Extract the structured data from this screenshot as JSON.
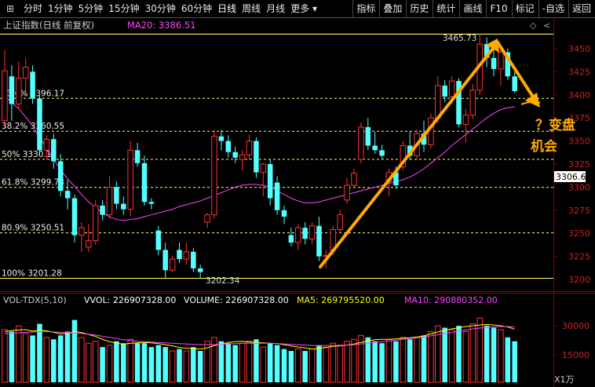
{
  "toolbar": {
    "left_icon": "⊞",
    "periods": [
      "分时",
      "1分钟",
      "5分钟",
      "15分钟",
      "30分钟",
      "60分钟",
      "日线",
      "周线",
      "月线",
      "更多 ▾"
    ],
    "active_period": "日线",
    "right_items": [
      "指标",
      "叠加",
      "历史",
      "统计",
      "画线",
      "F10",
      "标记",
      "-自选",
      "返回"
    ]
  },
  "colors": {
    "up": "#ff3232",
    "down": "#54ffff",
    "ma20": "#ff44ff",
    "ma5": "#ffffff",
    "ma10": "#ffff00",
    "fib": "#ffff66",
    "arrow": "#ffaa00",
    "grid": "#8b0000"
  },
  "main_panel": {
    "title": "上证指数(日线 前复权)",
    "ma_label": "MA20: 3386.51",
    "last_price": "3306.6",
    "high_label": "3465.73",
    "low_label": "3202.34",
    "annotation_line1": "？变盘",
    "annotation_line2": "机会",
    "icons": [
      "◇",
      "<"
    ]
  },
  "fib_levels": [
    {
      "label": "23.6% 3396.17",
      "value": 3396.17
    },
    {
      "label": "38.2% 3360.55",
      "value": 3360.55
    },
    {
      "label": "50% 3330.14",
      "value": 3330.14
    },
    {
      "label": "61.8% 3299.73",
      "value": 3299.73
    },
    {
      "label": "80.9% 3250.51",
      "value": 3250.51
    },
    {
      "label": "100% 3201.28",
      "value": 3201.28
    }
  ],
  "volume_panel": {
    "title": "VOL-TDX(5,10)",
    "vvol": "VVOL: 226907328.00",
    "volume": "VOLUME: 226907328.00",
    "ma5": "MA5: 269795520.00",
    "ma10": "MA10: 290880352.00",
    "unit": "X1万"
  },
  "chart_data": {
    "type": "candlestick",
    "price_axis": {
      "ylim": [
        3195,
        3463
      ],
      "ticks": [
        3200,
        3225,
        3250,
        3275,
        3300,
        3325,
        3350,
        3375,
        3400,
        3425,
        3450
      ]
    },
    "volume_axis": {
      "ylim": [
        8000,
        38000
      ],
      "ticks": [
        15000,
        30000
      ]
    },
    "candles": [
      {
        "o": 3372,
        "h": 3448,
        "l": 3364,
        "c": 3426,
        "v": 28000
      },
      {
        "o": 3420,
        "h": 3432,
        "l": 3372,
        "c": 3390,
        "v": 27000
      },
      {
        "o": 3390,
        "h": 3436,
        "l": 3385,
        "c": 3418,
        "v": 30000
      },
      {
        "o": 3418,
        "h": 3440,
        "l": 3400,
        "c": 3430,
        "v": 26000
      },
      {
        "o": 3425,
        "h": 3432,
        "l": 3390,
        "c": 3396,
        "v": 25000
      },
      {
        "o": 3396,
        "h": 3402,
        "l": 3335,
        "c": 3340,
        "v": 31000
      },
      {
        "o": 3340,
        "h": 3356,
        "l": 3330,
        "c": 3352,
        "v": 24000
      },
      {
        "o": 3352,
        "h": 3358,
        "l": 3320,
        "c": 3328,
        "v": 23000
      },
      {
        "o": 3328,
        "h": 3336,
        "l": 3290,
        "c": 3296,
        "v": 25000
      },
      {
        "o": 3296,
        "h": 3308,
        "l": 3276,
        "c": 3288,
        "v": 27000
      },
      {
        "o": 3288,
        "h": 3292,
        "l": 3240,
        "c": 3248,
        "v": 33000
      },
      {
        "o": 3248,
        "h": 3262,
        "l": 3230,
        "c": 3256,
        "v": 24000
      },
      {
        "o": 3235,
        "h": 3260,
        "l": 3230,
        "c": 3242,
        "v": 21000
      },
      {
        "o": 3242,
        "h": 3286,
        "l": 3238,
        "c": 3280,
        "v": 22000
      },
      {
        "o": 3280,
        "h": 3286,
        "l": 3264,
        "c": 3270,
        "v": 19000
      },
      {
        "o": 3270,
        "h": 3312,
        "l": 3266,
        "c": 3300,
        "v": 20000
      },
      {
        "o": 3300,
        "h": 3306,
        "l": 3276,
        "c": 3282,
        "v": 22000
      },
      {
        "o": 3282,
        "h": 3290,
        "l": 3270,
        "c": 3276,
        "v": 21000
      },
      {
        "o": 3276,
        "h": 3350,
        "l": 3268,
        "c": 3340,
        "v": 23000
      },
      {
        "o": 3340,
        "h": 3348,
        "l": 3322,
        "c": 3326,
        "v": 21000
      },
      {
        "o": 3326,
        "h": 3334,
        "l": 3280,
        "c": 3284,
        "v": 21000
      },
      {
        "o": 3284,
        "h": 3288,
        "l": 3276,
        "c": 3282,
        "v": 19000
      },
      {
        "o": 3253,
        "h": 3258,
        "l": 3226,
        "c": 3232,
        "v": 20000
      },
      {
        "o": 3232,
        "h": 3240,
        "l": 3202,
        "c": 3210,
        "v": 19000
      },
      {
        "o": 3210,
        "h": 3226,
        "l": 3208,
        "c": 3222,
        "v": 17000
      },
      {
        "o": 3232,
        "h": 3240,
        "l": 3218,
        "c": 3222,
        "v": 18000
      },
      {
        "o": 3222,
        "h": 3240,
        "l": 3216,
        "c": 3230,
        "v": 17000
      },
      {
        "o": 3230,
        "h": 3234,
        "l": 3208,
        "c": 3212,
        "v": 19000
      },
      {
        "o": 3212,
        "h": 3216,
        "l": 3202,
        "c": 3208,
        "v": 17000
      },
      {
        "o": 3262,
        "h": 3272,
        "l": 3256,
        "c": 3270,
        "v": 22000
      },
      {
        "o": 3270,
        "h": 3362,
        "l": 3266,
        "c": 3355,
        "v": 24000
      },
      {
        "o": 3355,
        "h": 3362,
        "l": 3340,
        "c": 3350,
        "v": 22000
      },
      {
        "o": 3350,
        "h": 3356,
        "l": 3332,
        "c": 3338,
        "v": 21000
      },
      {
        "o": 3338,
        "h": 3344,
        "l": 3326,
        "c": 3332,
        "v": 20000
      },
      {
        "o": 3330,
        "h": 3340,
        "l": 3318,
        "c": 3335,
        "v": 21000
      },
      {
        "o": 3335,
        "h": 3357,
        "l": 3330,
        "c": 3350,
        "v": 22000
      },
      {
        "o": 3350,
        "h": 3354,
        "l": 3310,
        "c": 3316,
        "v": 23000
      },
      {
        "o": 3316,
        "h": 3326,
        "l": 3290,
        "c": 3325,
        "v": 19000
      },
      {
        "o": 3325,
        "h": 3330,
        "l": 3280,
        "c": 3288,
        "v": 21000
      },
      {
        "o": 3305,
        "h": 3312,
        "l": 3270,
        "c": 3275,
        "v": 20000
      },
      {
        "o": 3275,
        "h": 3280,
        "l": 3260,
        "c": 3268,
        "v": 18000
      },
      {
        "o": 3248,
        "h": 3256,
        "l": 3236,
        "c": 3240,
        "v": 17000
      },
      {
        "o": 3240,
        "h": 3260,
        "l": 3232,
        "c": 3256,
        "v": 18000
      },
      {
        "o": 3256,
        "h": 3262,
        "l": 3238,
        "c": 3244,
        "v": 17000
      },
      {
        "o": 3244,
        "h": 3262,
        "l": 3238,
        "c": 3258,
        "v": 18000
      },
      {
        "o": 3258,
        "h": 3268,
        "l": 3220,
        "c": 3225,
        "v": 20000
      },
      {
        "o": 3225,
        "h": 3232,
        "l": 3212,
        "c": 3226,
        "v": 19000
      },
      {
        "o": 3232,
        "h": 3258,
        "l": 3226,
        "c": 3254,
        "v": 21000
      },
      {
        "o": 3254,
        "h": 3275,
        "l": 3250,
        "c": 3270,
        "v": 20000
      },
      {
        "o": 3286,
        "h": 3310,
        "l": 3282,
        "c": 3302,
        "v": 22000
      },
      {
        "o": 3302,
        "h": 3320,
        "l": 3298,
        "c": 3315,
        "v": 23000
      },
      {
        "o": 3330,
        "h": 3370,
        "l": 3326,
        "c": 3365,
        "v": 25000
      },
      {
        "o": 3365,
        "h": 3375,
        "l": 3340,
        "c": 3345,
        "v": 24000
      },
      {
        "o": 3345,
        "h": 3360,
        "l": 3336,
        "c": 3340,
        "v": 22000
      },
      {
        "o": 3340,
        "h": 3346,
        "l": 3330,
        "c": 3334,
        "v": 21000
      },
      {
        "o": 3306,
        "h": 3320,
        "l": 3290,
        "c": 3316,
        "v": 23000
      },
      {
        "o": 3316,
        "h": 3322,
        "l": 3298,
        "c": 3302,
        "v": 22000
      },
      {
        "o": 3322,
        "h": 3350,
        "l": 3318,
        "c": 3345,
        "v": 24000
      },
      {
        "o": 3345,
        "h": 3360,
        "l": 3330,
        "c": 3334,
        "v": 23000
      },
      {
        "o": 3334,
        "h": 3362,
        "l": 3330,
        "c": 3358,
        "v": 24000
      },
      {
        "o": 3358,
        "h": 3372,
        "l": 3338,
        "c": 3346,
        "v": 25000
      },
      {
        "o": 3346,
        "h": 3380,
        "l": 3342,
        "c": 3375,
        "v": 27000
      },
      {
        "o": 3375,
        "h": 3420,
        "l": 3370,
        "c": 3410,
        "v": 30000
      },
      {
        "o": 3410,
        "h": 3416,
        "l": 3392,
        "c": 3398,
        "v": 29000
      },
      {
        "o": 3398,
        "h": 3420,
        "l": 3390,
        "c": 3415,
        "v": 28000
      },
      {
        "o": 3415,
        "h": 3418,
        "l": 3365,
        "c": 3368,
        "v": 30000
      },
      {
        "o": 3368,
        "h": 3385,
        "l": 3348,
        "c": 3378,
        "v": 27000
      },
      {
        "o": 3378,
        "h": 3412,
        "l": 3374,
        "c": 3405,
        "v": 31000
      },
      {
        "o": 3405,
        "h": 3465,
        "l": 3400,
        "c": 3455,
        "v": 34000
      },
      {
        "o": 3455,
        "h": 3462,
        "l": 3430,
        "c": 3440,
        "v": 30000
      },
      {
        "o": 3440,
        "h": 3452,
        "l": 3420,
        "c": 3428,
        "v": 29000
      },
      {
        "o": 3428,
        "h": 3450,
        "l": 3410,
        "c": 3446,
        "v": 28000
      },
      {
        "o": 3446,
        "h": 3450,
        "l": 3416,
        "c": 3420,
        "v": 24000
      },
      {
        "o": 3420,
        "h": 3425,
        "l": 3402,
        "c": 3404,
        "v": 22000
      }
    ],
    "ma20": [
      3398,
      3392,
      3385,
      3376,
      3366,
      3354,
      3342,
      3330,
      3319,
      3309,
      3301,
      3292,
      3284,
      3278,
      3272,
      3268,
      3265,
      3264,
      3265,
      3266,
      3268,
      3270,
      3272,
      3274,
      3276,
      3279,
      3281,
      3283,
      3285,
      3288,
      3291,
      3294,
      3297,
      3300,
      3302,
      3303,
      3303,
      3302,
      3300,
      3296,
      3292,
      3288,
      3285,
      3283,
      3283,
      3284,
      3286,
      3288,
      3290,
      3292,
      3294,
      3296,
      3298,
      3300,
      3302,
      3304,
      3306,
      3308,
      3311,
      3315,
      3320,
      3326,
      3332,
      3338,
      3345,
      3351,
      3357,
      3363,
      3369,
      3375,
      3380,
      3384,
      3386,
      3387
    ],
    "vol_ma5": [
      27000,
      27500,
      27800,
      28000,
      27200,
      27800,
      27400,
      26600,
      25800,
      26000,
      27000,
      26500,
      25500,
      24500,
      23000,
      21800,
      21000,
      20500,
      21000,
      21200,
      21400,
      21200,
      20800,
      20200,
      19600,
      18800,
      18400,
      18200,
      18000,
      18600,
      19800,
      20600,
      21400,
      21800,
      22000,
      21600,
      21400,
      21200,
      21000,
      20800,
      20200,
      19600,
      19000,
      18600,
      18000,
      18400,
      18800,
      19400,
      19600,
      20000,
      20600,
      21400,
      22200,
      22800,
      23000,
      23000,
      23200,
      23600,
      23800,
      24200,
      24800,
      25800,
      26800,
      27600,
      28400,
      29000,
      29600,
      30000,
      30400,
      30600,
      30400,
      30000,
      29400,
      28200
    ],
    "vol_ma10": [
      26000,
      26200,
      26400,
      26600,
      26800,
      27000,
      27000,
      26800,
      26600,
      26400,
      26200,
      26000,
      25600,
      25200,
      24600,
      24000,
      23400,
      22800,
      22400,
      22000,
      21800,
      21600,
      21400,
      21200,
      21000,
      20800,
      20600,
      20400,
      20200,
      20200,
      20200,
      20400,
      20600,
      20800,
      21000,
      21000,
      21000,
      21000,
      21000,
      20800,
      20600,
      20400,
      20200,
      20000,
      19800,
      19800,
      19800,
      19800,
      19800,
      20000,
      20200,
      20600,
      21000,
      21400,
      21800,
      22200,
      22600,
      23000,
      23400,
      23800,
      24200,
      24800,
      25400,
      26000,
      26600,
      27200,
      27800,
      28400,
      28800,
      29200,
      29400,
      29600,
      29600,
      29400
    ]
  }
}
